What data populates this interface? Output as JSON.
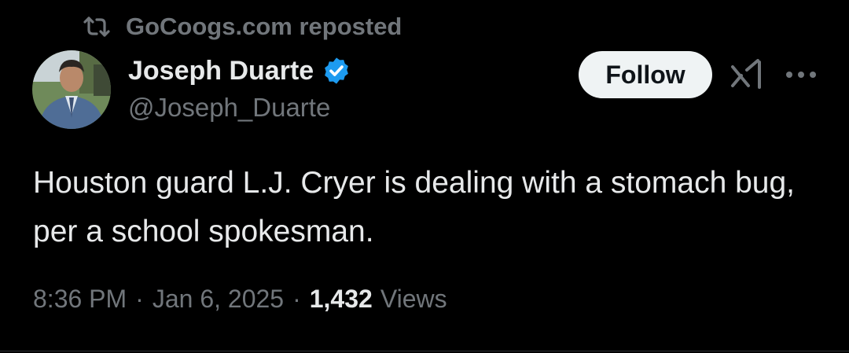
{
  "repost": {
    "icon": "repost-icon",
    "text": "GoCoogs.com reposted"
  },
  "author": {
    "avatar": "avatar",
    "display_name": "Joseph Duarte",
    "verified_icon": "verified-badge-icon",
    "handle": "@Joseph_Duarte"
  },
  "actions": {
    "follow_label": "Follow",
    "grok_icon": "grok-icon",
    "more_icon": "more-icon"
  },
  "tweet": {
    "text": "Houston guard L.J. Cryer is dealing with a stomach bug, per a school spokesman."
  },
  "meta": {
    "time": "8:36 PM",
    "separator": "·",
    "date": "Jan 6, 2025",
    "views_count": "1,432",
    "views_label": "Views"
  },
  "colors": {
    "background": "#000000",
    "primary_text": "#e7e9ea",
    "secondary_text": "#71767b",
    "verified_blue": "#1d9bf0",
    "follow_button_bg": "#eff3f4",
    "follow_button_text": "#0f1419"
  }
}
